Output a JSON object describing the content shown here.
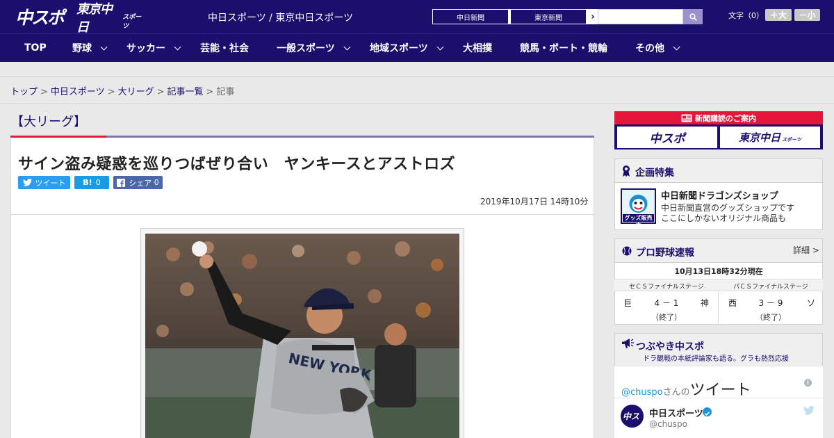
{
  "header": {
    "logo_main": "中スポ",
    "logo_sub": "東京中日",
    "logo_sub_small": "スポーツ",
    "site_name": "中日スポーツ / 東京中日スポーツ",
    "paper_links": [
      "中日新聞",
      "東京新聞"
    ],
    "font_size_label": "文字（0）",
    "font_larger": "＋大",
    "font_smaller": "－小",
    "search_placeholder": ""
  },
  "nav": {
    "items": [
      {
        "label": "TOP",
        "has_menu": false
      },
      {
        "label": "野球",
        "has_menu": true
      },
      {
        "label": "サッカー",
        "has_menu": true
      },
      {
        "label": "芸能・社会",
        "has_menu": false
      },
      {
        "label": "一般スポーツ",
        "has_menu": true
      },
      {
        "label": "地域スポーツ",
        "has_menu": true
      },
      {
        "label": "大相撲",
        "has_menu": false
      },
      {
        "label": "競馬・ボート・競輪",
        "has_menu": false
      },
      {
        "label": "その他",
        "has_menu": true
      }
    ]
  },
  "breadcrumb": [
    "トップ",
    "中日スポーツ",
    "大リーグ",
    "記事一覧",
    "記事"
  ],
  "article": {
    "category": "【大リーグ】",
    "headline": "サイン盗み疑惑を巡りつばぜり合い　ヤンキースとアストロズ",
    "share": {
      "tweet_label": "ツイート",
      "hatena_label": "B!",
      "hatena_count": "0",
      "facebook_label": "シェア",
      "facebook_count": "0"
    },
    "date": "2019年10月17日 14時10分"
  },
  "sidebar": {
    "subscription": {
      "title": "新聞購読のご案内",
      "papers": [
        "中スポ",
        "東京中日"
      ],
      "papers_small": "スポーツ"
    },
    "feature": {
      "title": "企画特集",
      "item_title": "中日新聞ドラゴンズショップ",
      "item_desc_1": "中日新聞直営のグッズショップです",
      "item_desc_2": "ここにしかないオリジナル商品も",
      "icon_caption": "グッズ販売中"
    },
    "baseball": {
      "title": "プロ野球速報",
      "more": "詳細 >",
      "as_of": "10月13日18時32分現在",
      "stages": [
        "セＣＳファイナルステージ",
        "パＣＳファイナルステージ"
      ],
      "games": [
        {
          "home": "巨",
          "score": "4 － 1",
          "away": "神",
          "status": "（終了）"
        },
        {
          "home": "西",
          "score": "3 － 9",
          "away": "ソ",
          "status": "（終了）"
        }
      ]
    },
    "tweets": {
      "title": "つぶやき中スポ",
      "subtitle": "ドラ観戦の本紙評論家も語る。グラも熱烈応援",
      "handle": "@chuspo",
      "handle_suffix": "さんの",
      "heading": "ツイート",
      "account_name": "中日スポーツ",
      "account_user": "@chuspo"
    }
  }
}
